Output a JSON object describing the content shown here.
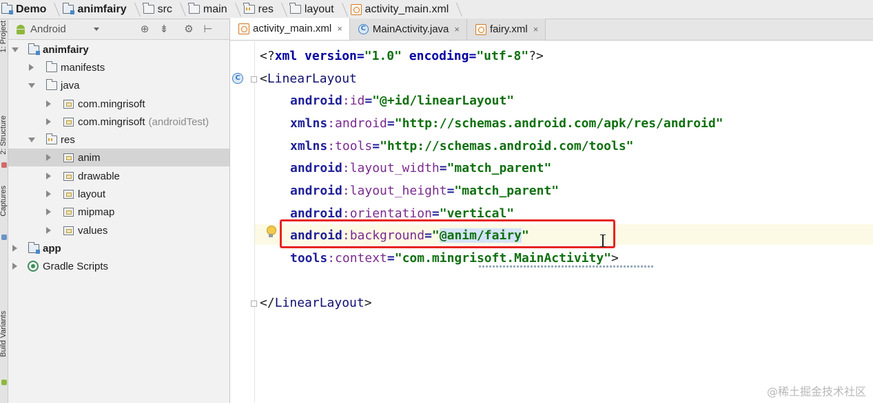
{
  "breadcrumb": {
    "items": [
      "Demo",
      "animfairy",
      "src",
      "main",
      "res",
      "layout",
      "activity_main.xml"
    ]
  },
  "tool_strip": {
    "labels": [
      "1: Project",
      "2: Structure",
      "Captures",
      "Build Variants"
    ]
  },
  "project_panel": {
    "view_mode": "Android",
    "tree": [
      {
        "label": "animfairy",
        "hint": ""
      },
      {
        "label": "manifests",
        "hint": ""
      },
      {
        "label": "java",
        "hint": ""
      },
      {
        "label": "com.mingrisoft",
        "hint": ""
      },
      {
        "label": "com.mingrisoft",
        "hint": "(androidTest)"
      },
      {
        "label": "res",
        "hint": ""
      },
      {
        "label": "anim",
        "hint": ""
      },
      {
        "label": "drawable",
        "hint": ""
      },
      {
        "label": "layout",
        "hint": ""
      },
      {
        "label": "mipmap",
        "hint": ""
      },
      {
        "label": "values",
        "hint": ""
      },
      {
        "label": "app",
        "hint": ""
      },
      {
        "label": "Gradle Scripts",
        "hint": ""
      }
    ]
  },
  "tabs": [
    {
      "label": "activity_main.xml",
      "close": "×"
    },
    {
      "label": "MainActivity.java",
      "close": "×"
    },
    {
      "label": "fairy.xml",
      "close": "×"
    }
  ],
  "code": {
    "l1": {
      "a": "<?",
      "b": "xml version",
      "c": "=",
      "d": "\"1.0\"",
      "e": " encoding",
      "f": "=",
      "g": "\"utf-8\"",
      "h": "?>"
    },
    "l2": {
      "a": "<",
      "b": "LinearLayout"
    },
    "l3": {
      "a": "android",
      "b": ":id",
      "c": "=",
      "d": "\"@+id/linearLayout\""
    },
    "l4": {
      "a": "xmlns",
      "b": ":android",
      "c": "=",
      "d": "\"http://schemas.android.com/apk/res/android\""
    },
    "l5": {
      "a": "xmlns",
      "b": ":tools",
      "c": "=",
      "d": "\"http://schemas.android.com/tools\""
    },
    "l6": {
      "a": "android",
      "b": ":layout_width",
      "c": "=",
      "d": "\"match_parent\""
    },
    "l7": {
      "a": "android",
      "b": ":layout_height",
      "c": "=",
      "d": "\"match_parent\""
    },
    "l8": {
      "a": "android",
      "b": ":orientation",
      "c": "=",
      "d": "\"vertical\""
    },
    "l9": {
      "a": "android",
      "b": ":background",
      "c": "=",
      "d": "\"",
      "e": "@anim/fairy",
      "f": "\""
    },
    "l10": {
      "a": "tools",
      "b": ":context",
      "c": "=",
      "d": "\"com.mingrisoft.MainActivity\"",
      "e": ">"
    },
    "l11": {
      "a": "</",
      "b": "LinearLayout",
      "c": ">"
    }
  },
  "gutter": {
    "class_marker": "C"
  },
  "watermark": "@稀土掘金技术社区"
}
